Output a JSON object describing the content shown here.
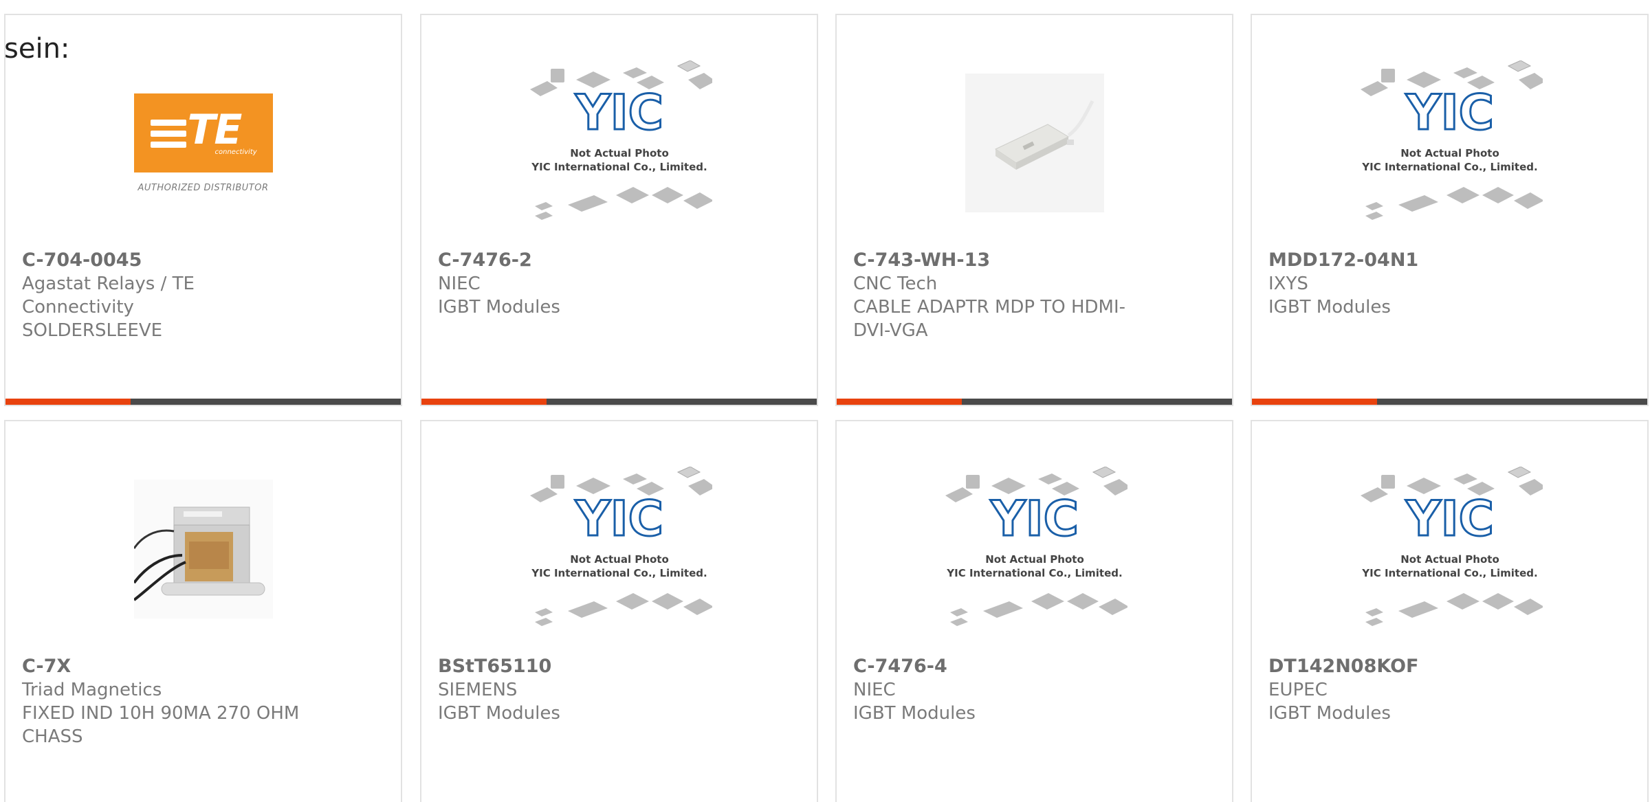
{
  "intro": {
    "text": "sein:"
  },
  "brand": {
    "accent_color": "#e8420e",
    "bar_color": "#4a4a4a",
    "border_color": "#e2e2e2",
    "te_orange": "#f39322",
    "yic_blue": "#1a5fa8"
  },
  "te_logo": {
    "letters": "TE",
    "sub": "connectivity",
    "caption": "AUTHORIZED DISTRIBUTOR"
  },
  "yic_placeholder": {
    "logo_text": "YIC",
    "line1": "Not Actual Photo",
    "line2": "YIC International Co., Limited."
  },
  "products": [
    {
      "image": "te-connectivity-logo",
      "part_number": "C-704-0045",
      "manufacturer": "Agastat Relays / TE Connectivity",
      "description": "SOLDERSLEEVE"
    },
    {
      "image": "yic-placeholder",
      "part_number": "C-7476-2",
      "manufacturer": "NIEC",
      "description": "IGBT Modules"
    },
    {
      "image": "cable-adapter-photo",
      "part_number": "C-743-WH-13",
      "manufacturer": "CNC Tech",
      "description": "CABLE ADAPTR MDP TO HDMI-DVI-VGA",
      "description_lines": [
        "CABLE ADAPTR MDP TO HDMI-",
        "DVI-VGA"
      ]
    },
    {
      "image": "yic-placeholder",
      "part_number": "MDD172-04N1",
      "manufacturer": "IXYS",
      "description": "IGBT Modules"
    },
    {
      "image": "inductor-photo",
      "part_number": "C-7X",
      "manufacturer": "Triad Magnetics",
      "description": "FIXED IND 10H 90MA 270 OHM CHASS",
      "description_lines": [
        "FIXED IND 10H 90MA 270 OHM",
        "CHASS"
      ]
    },
    {
      "image": "yic-placeholder",
      "part_number": "BStT65110",
      "manufacturer": "SIEMENS",
      "description": "IGBT Modules"
    },
    {
      "image": "yic-placeholder",
      "part_number": "C-7476-4",
      "manufacturer": "NIEC",
      "description": "IGBT Modules"
    },
    {
      "image": "yic-placeholder",
      "part_number": "DT142N08KOF",
      "manufacturer": "EUPEC",
      "description": "IGBT Modules"
    }
  ]
}
